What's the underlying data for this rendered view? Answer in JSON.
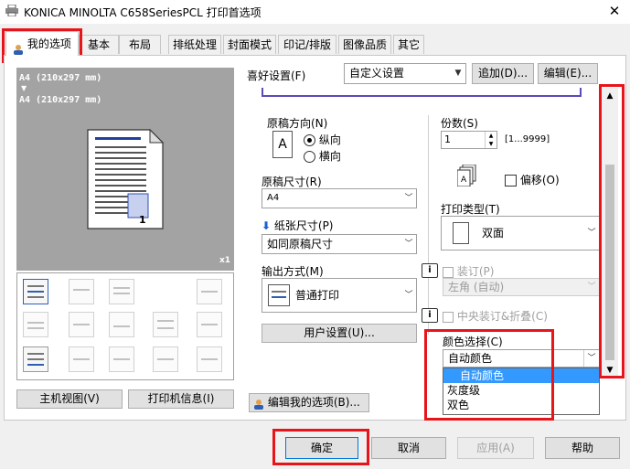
{
  "window": {
    "title": "KONICA MINOLTA C658SeriesPCL 打印首选项",
    "close": "✕"
  },
  "tabs": [
    "我的选项",
    "基本",
    "布局",
    "排纸处理",
    "封面模式",
    "印记/排版",
    "图像品质",
    "其它"
  ],
  "preview": {
    "line1": "A4 (210x297 mm)",
    "arrow": "▼",
    "line2": "A4 (210x297 mm)",
    "page_num": "1",
    "scale": "x1"
  },
  "favorites": {
    "label": "喜好设置(F)",
    "value": "自定义设置",
    "add": "追加(D)...",
    "edit": "编辑(E)..."
  },
  "orientation": {
    "label": "原稿方向(N)",
    "portrait": "纵向",
    "landscape": "横向",
    "icon_letter": "A"
  },
  "copies": {
    "label": "份数(S)",
    "value": "1",
    "range": "[1...9999]",
    "offset": "偏移(O)"
  },
  "original_size": {
    "label": "原稿尺寸(R)",
    "value": "A4"
  },
  "paper_size": {
    "label": "纸张尺寸(P)",
    "value": "如同原稿尺寸"
  },
  "print_type": {
    "label": "打印类型(T)",
    "value": "双面"
  },
  "output": {
    "label": "输出方式(M)",
    "value": "普通打印"
  },
  "staple": {
    "label": "装订(P)",
    "value": "左角 (自动)"
  },
  "center_staple": {
    "label": "中央装订&折叠(C)"
  },
  "user_settings": {
    "label": "用户设置(U)..."
  },
  "color": {
    "label": "颜色选择(C)",
    "value": "自动颜色",
    "options": [
      "自动颜色",
      "灰度级",
      "双色"
    ]
  },
  "left_buttons": {
    "host_view": "主机视图(V)",
    "printer_info": "打印机信息(I)"
  },
  "edit_my_options": "编辑我的选项(B)...",
  "bottom": {
    "ok": "确定",
    "cancel": "取消",
    "apply": "应用(A)",
    "help": "帮助"
  },
  "accent": "#e8141b",
  "highlight": "#3399ff"
}
